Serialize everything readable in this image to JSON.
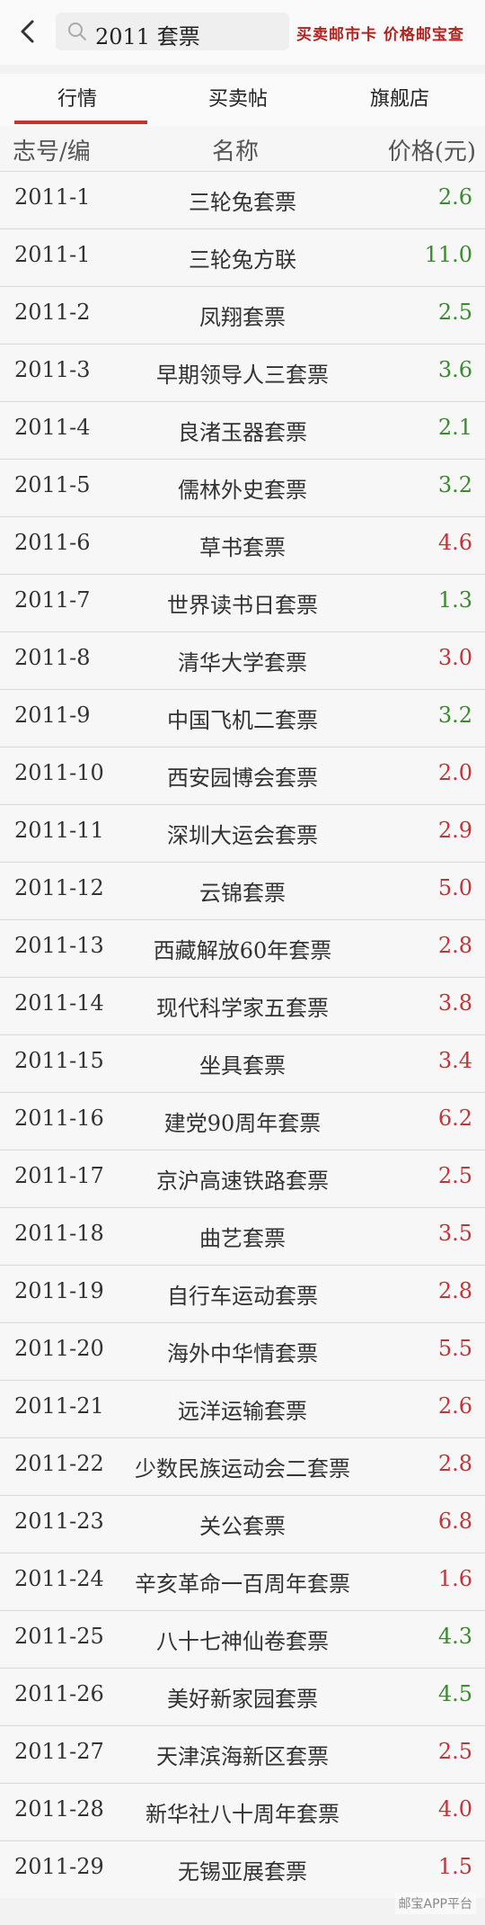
{
  "header": {
    "search_text": "2011 套票",
    "slogan": "买卖邮市卡 价格邮宝查"
  },
  "tabs": [
    {
      "label": "行情",
      "active": true
    },
    {
      "label": "买卖帖",
      "active": false
    },
    {
      "label": "旗舰店",
      "active": false
    }
  ],
  "table": {
    "columns": [
      "志号/编",
      "名称",
      "价格(元)"
    ],
    "rows": [
      {
        "code": "2011-1",
        "name": "三轮兔套票",
        "price": "2.6",
        "trend": "down"
      },
      {
        "code": "2011-1",
        "name": "三轮兔方联",
        "price": "11.0",
        "trend": "down"
      },
      {
        "code": "2011-2",
        "name": "凤翔套票",
        "price": "2.5",
        "trend": "down"
      },
      {
        "code": "2011-3",
        "name": "早期领导人三套票",
        "price": "3.6",
        "trend": "down"
      },
      {
        "code": "2011-4",
        "name": "良渚玉器套票",
        "price": "2.1",
        "trend": "down"
      },
      {
        "code": "2011-5",
        "name": "儒林外史套票",
        "price": "3.2",
        "trend": "down"
      },
      {
        "code": "2011-6",
        "name": "草书套票",
        "price": "4.6",
        "trend": "up"
      },
      {
        "code": "2011-7",
        "name": "世界读书日套票",
        "price": "1.3",
        "trend": "down"
      },
      {
        "code": "2011-8",
        "name": "清华大学套票",
        "price": "3.0",
        "trend": "up"
      },
      {
        "code": "2011-9",
        "name": "中国飞机二套票",
        "price": "3.2",
        "trend": "down"
      },
      {
        "code": "2011-10",
        "name": "西安园博会套票",
        "price": "2.0",
        "trend": "up"
      },
      {
        "code": "2011-11",
        "name": "深圳大运会套票",
        "price": "2.9",
        "trend": "up"
      },
      {
        "code": "2011-12",
        "name": "云锦套票",
        "price": "5.0",
        "trend": "up"
      },
      {
        "code": "2011-13",
        "name": "西藏解放60年套票",
        "price": "2.8",
        "trend": "up"
      },
      {
        "code": "2011-14",
        "name": "现代科学家五套票",
        "price": "3.8",
        "trend": "up"
      },
      {
        "code": "2011-15",
        "name": "坐具套票",
        "price": "3.4",
        "trend": "up"
      },
      {
        "code": "2011-16",
        "name": "建党90周年套票",
        "price": "6.2",
        "trend": "up"
      },
      {
        "code": "2011-17",
        "name": "京沪高速铁路套票",
        "price": "2.5",
        "trend": "up"
      },
      {
        "code": "2011-18",
        "name": "曲艺套票",
        "price": "3.5",
        "trend": "up"
      },
      {
        "code": "2011-19",
        "name": "自行车运动套票",
        "price": "2.8",
        "trend": "up"
      },
      {
        "code": "2011-20",
        "name": "海外中华情套票",
        "price": "5.5",
        "trend": "up"
      },
      {
        "code": "2011-21",
        "name": "远洋运输套票",
        "price": "2.6",
        "trend": "up"
      },
      {
        "code": "2011-22",
        "name": "少数民族运动会二套票",
        "price": "2.8",
        "trend": "up"
      },
      {
        "code": "2011-23",
        "name": "关公套票",
        "price": "6.8",
        "trend": "up"
      },
      {
        "code": "2011-24",
        "name": "辛亥革命一百周年套票",
        "price": "1.6",
        "trend": "up"
      },
      {
        "code": "2011-25",
        "name": "八十七神仙卷套票",
        "price": "4.3",
        "trend": "down"
      },
      {
        "code": "2011-26",
        "name": "美好新家园套票",
        "price": "4.5",
        "trend": "down"
      },
      {
        "code": "2011-27",
        "name": "天津滨海新区套票",
        "price": "2.5",
        "trend": "up"
      },
      {
        "code": "2011-28",
        "name": "新华社八十周年套票",
        "price": "4.0",
        "trend": "up"
      },
      {
        "code": "2011-29",
        "name": "无锡亚展套票",
        "price": "1.5",
        "trend": "up"
      }
    ]
  },
  "watermark": "邮宝APP平台",
  "colors": {
    "up": "#c0353a",
    "down": "#3b8a2e",
    "accent": "#c8322b"
  }
}
